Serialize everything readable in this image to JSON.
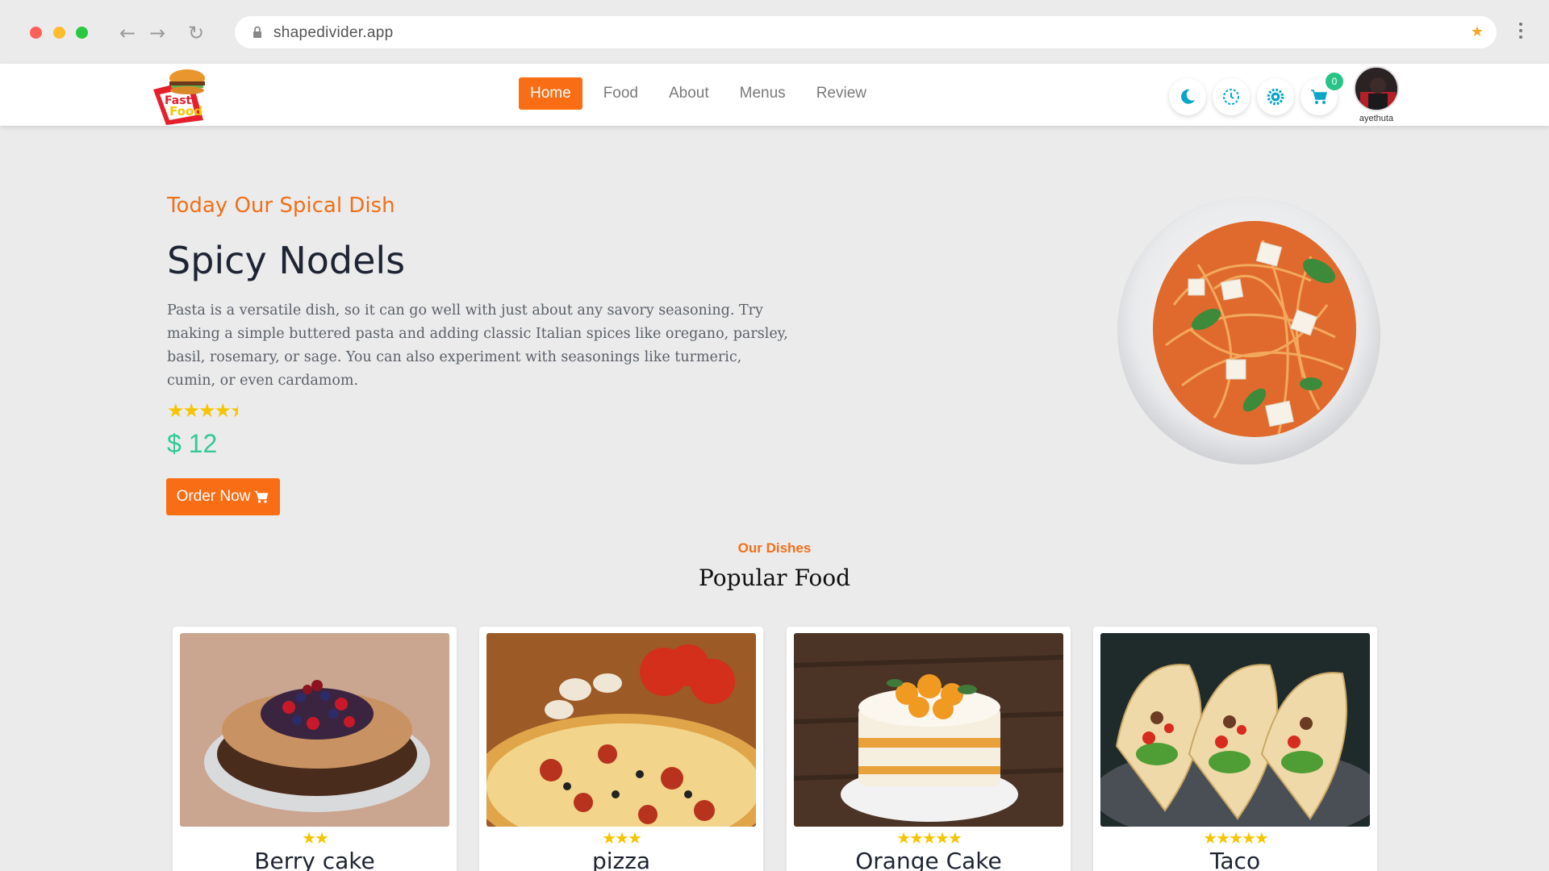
{
  "browser": {
    "url": "shapedivider.app"
  },
  "header": {
    "logo_text_1": "Fast",
    "logo_text_2": "Food",
    "nav": [
      "Home",
      "Food",
      "About",
      "Menus",
      "Review"
    ],
    "active_nav": "Home",
    "cart_count": "0",
    "username": "ayethuta",
    "icons": [
      "moon-icon",
      "clock-icon",
      "gear-icon",
      "cart-icon"
    ]
  },
  "hero": {
    "subtitle": "Today Our Spical Dish",
    "title": "Spicy Nodels",
    "description": "Pasta is a versatile dish, so it can go well with just about any savory seasoning. Try making a simple buttered pasta and adding classic Italian spices like oregano, parsley, basil, rosemary, or sage. You can also experiment with seasonings like turmeric, cumin, or even cardamom.",
    "rating": 4.5,
    "price": "$ 12",
    "order_label": "Order Now"
  },
  "section": {
    "subtitle": "Our Dishes",
    "title": "Popular Food"
  },
  "dishes": [
    {
      "name": "Berry cake",
      "rating": 2
    },
    {
      "name": "pizza",
      "rating": 3
    },
    {
      "name": "Orange Cake",
      "rating": 5
    },
    {
      "name": "Taco",
      "rating": 5
    }
  ],
  "colors": {
    "accent": "#f96d14",
    "price": "#33c994",
    "icon": "#0aa5c9",
    "star": "#f6c500"
  }
}
